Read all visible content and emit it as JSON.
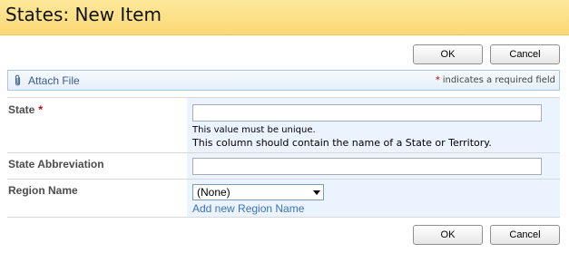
{
  "page": {
    "title": "States: New Item"
  },
  "buttons": {
    "ok_label": "OK",
    "cancel_label": "Cancel"
  },
  "toolbar": {
    "attach_label": "Attach File",
    "required_star": "*",
    "required_note": "indicates a required field"
  },
  "form": {
    "state": {
      "label": "State",
      "required_star": "*",
      "value": "",
      "hint_unique": "This value must be unique.",
      "hint_description": "This column should contain the name of a State or Territory."
    },
    "abbreviation": {
      "label": "State Abbreviation",
      "value": ""
    },
    "region": {
      "label": "Region Name",
      "selected": "(None)",
      "add_link": "Add new Region Name"
    }
  },
  "colors": {
    "title_bar": "#fbd876",
    "field_background": "#ebf3ff",
    "required": "#cc0000",
    "link": "#3b73b9"
  }
}
